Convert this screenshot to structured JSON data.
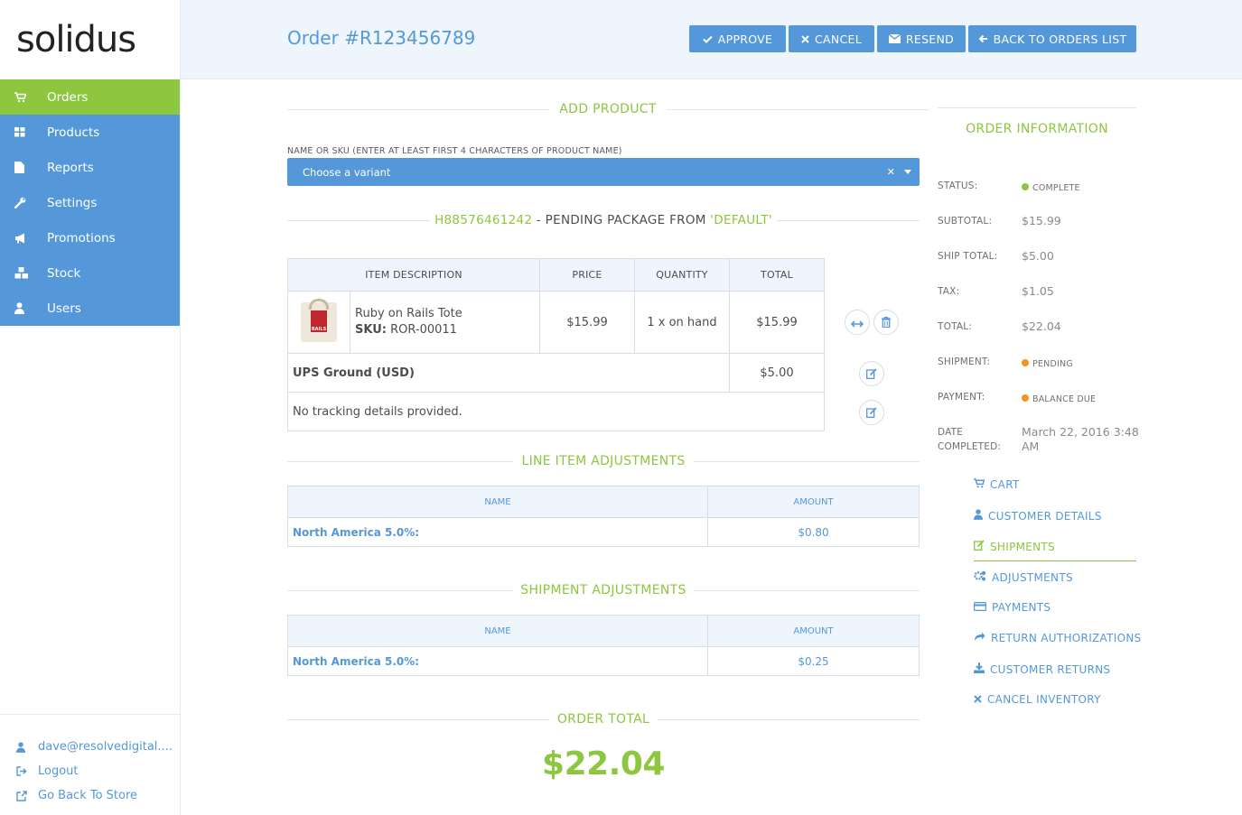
{
  "brand": {
    "logo": "solidus"
  },
  "sidebar": {
    "items": [
      {
        "label": "Orders",
        "icon": "cart-icon",
        "active": true
      },
      {
        "label": "Products",
        "icon": "grid-icon"
      },
      {
        "label": "Reports",
        "icon": "file-icon"
      },
      {
        "label": "Settings",
        "icon": "wrench-icon"
      },
      {
        "label": "Promotions",
        "icon": "megaphone-icon"
      },
      {
        "label": "Stock",
        "icon": "cubes-icon"
      },
      {
        "label": "Users",
        "icon": "user-icon"
      }
    ],
    "footer": {
      "user": "dave@resolvedigital....",
      "logout": "Logout",
      "store": "Go Back To Store"
    }
  },
  "header": {
    "title": "Order #R123456789",
    "buttons": {
      "approve": "APPROVE",
      "cancel": "CANCEL",
      "resend": "RESEND",
      "back": "BACK TO ORDERS LIST"
    }
  },
  "add_product": {
    "heading": "ADD PRODUCT",
    "field_label": "NAME OR SKU (ENTER AT LEAST FIRST 4 CHARACTERS OF PRODUCT NAME)",
    "select_placeholder": "Choose a variant"
  },
  "package": {
    "number": "H88576461242",
    "heading_rest": " - PENDING PACKAGE FROM ",
    "stock_location": "'DEFAULT'",
    "columns": [
      "ITEM DESCRIPTION",
      "PRICE",
      "QUANTITY",
      "TOTAL"
    ],
    "item": {
      "name": "Ruby on Rails Tote",
      "sku_label": "SKU:",
      "sku": "ROR-00011",
      "price": "$15.99",
      "quantity": "1 x on hand",
      "total": "$15.99",
      "image_label": "RAILS"
    },
    "shipping": {
      "method": "UPS Ground (USD)",
      "cost": "$5.00"
    },
    "tracking": "No tracking details provided."
  },
  "line_item_adjustments": {
    "heading": "LINE ITEM ADJUSTMENTS",
    "columns": [
      "NAME",
      "AMOUNT"
    ],
    "rows": [
      {
        "name": "North America 5.0%:",
        "amount": "$0.80"
      }
    ]
  },
  "shipment_adjustments": {
    "heading": "SHIPMENT ADJUSTMENTS",
    "columns": [
      "NAME",
      "AMOUNT"
    ],
    "rows": [
      {
        "name": "North America 5.0%:",
        "amount": "$0.25"
      }
    ]
  },
  "order_total": {
    "heading": "ORDER TOTAL",
    "value": "$22.04"
  },
  "order_info": {
    "heading": "ORDER INFORMATION",
    "status": {
      "label": "STATUS:",
      "value": "COMPLETE",
      "color": "#8dc63f"
    },
    "subtotal": {
      "label": "SUBTOTAL:",
      "value": "$15.99"
    },
    "ship_total": {
      "label": "SHIP TOTAL:",
      "value": "$5.00"
    },
    "tax": {
      "label": "TAX:",
      "value": "$1.05"
    },
    "total": {
      "label": "TOTAL:",
      "value": "$22.04"
    },
    "shipment": {
      "label": "SHIPMENT:",
      "value": "PENDING",
      "color": "#f7931e"
    },
    "payment": {
      "label": "PAYMENT:",
      "value": "BALANCE DUE",
      "color": "#f7931e"
    },
    "date_completed": {
      "label_line1": "DATE",
      "label_line2": "COMPLETED:",
      "value_line1": "March 22, 2016 3:48",
      "value_line2": "AM"
    }
  },
  "order_tabs": [
    {
      "label": "CART",
      "icon": "cart-icon"
    },
    {
      "label": "CUSTOMER DETAILS",
      "icon": "user-icon"
    },
    {
      "label": "SHIPMENTS",
      "icon": "edit-icon",
      "active": true
    },
    {
      "label": "ADJUSTMENTS",
      "icon": "gears-icon"
    },
    {
      "label": "PAYMENTS",
      "icon": "credit-card-icon"
    },
    {
      "label": "RETURN AUTHORIZATIONS",
      "icon": "share-icon"
    },
    {
      "label": "CUSTOMER RETURNS",
      "icon": "download-icon"
    },
    {
      "label": "CANCEL INVENTORY",
      "icon": "times-icon"
    }
  ],
  "colors": {
    "primary": "#5498da",
    "accent": "#8dc63f",
    "warning": "#f7931e"
  }
}
